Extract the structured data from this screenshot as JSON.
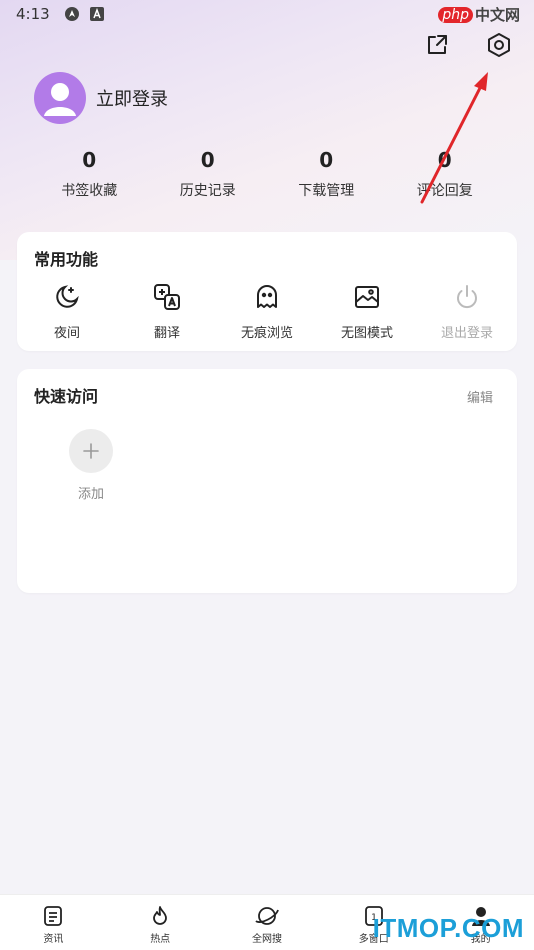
{
  "status_bar": {
    "time": "4:13",
    "icons": [
      "nav-icon",
      "a-badge-icon"
    ],
    "watermark_logo": "php",
    "watermark_text": "中文网"
  },
  "top_actions": {
    "share_icon": "share-icon",
    "settings_icon": "settings-hexagon-icon"
  },
  "profile": {
    "login_label": "立即登录"
  },
  "stats": [
    {
      "value": "0",
      "label": "书签收藏"
    },
    {
      "value": "0",
      "label": "历史记录"
    },
    {
      "value": "0",
      "label": "下载管理"
    },
    {
      "value": "0",
      "label": "评论回复"
    }
  ],
  "common_functions": {
    "title": "常用功能",
    "items": [
      {
        "label": "夜间",
        "icon": "moon-icon"
      },
      {
        "label": "翻译",
        "icon": "translate-icon"
      },
      {
        "label": "无痕浏览",
        "icon": "ghost-icon"
      },
      {
        "label": "无图模式",
        "icon": "no-image-icon"
      },
      {
        "label": "退出登录",
        "icon": "power-icon"
      }
    ]
  },
  "quick_access": {
    "title": "快速访问",
    "edit_label": "编辑",
    "add_label": "添加"
  },
  "tabbar": [
    {
      "label": "资讯",
      "icon": "news-icon"
    },
    {
      "label": "热点",
      "icon": "flame-icon"
    },
    {
      "label": "全网搜",
      "icon": "planet-icon"
    },
    {
      "label": "多窗口",
      "icon": "windows-icon"
    },
    {
      "label": "我的",
      "icon": "profile-icon"
    }
  ],
  "tab_window_count": "1",
  "watermark": "ITMOP.COM",
  "colors": {
    "avatar": "#b27be8",
    "annotation_arrow": "#e0262a",
    "watermark": "#1c9fd8"
  }
}
